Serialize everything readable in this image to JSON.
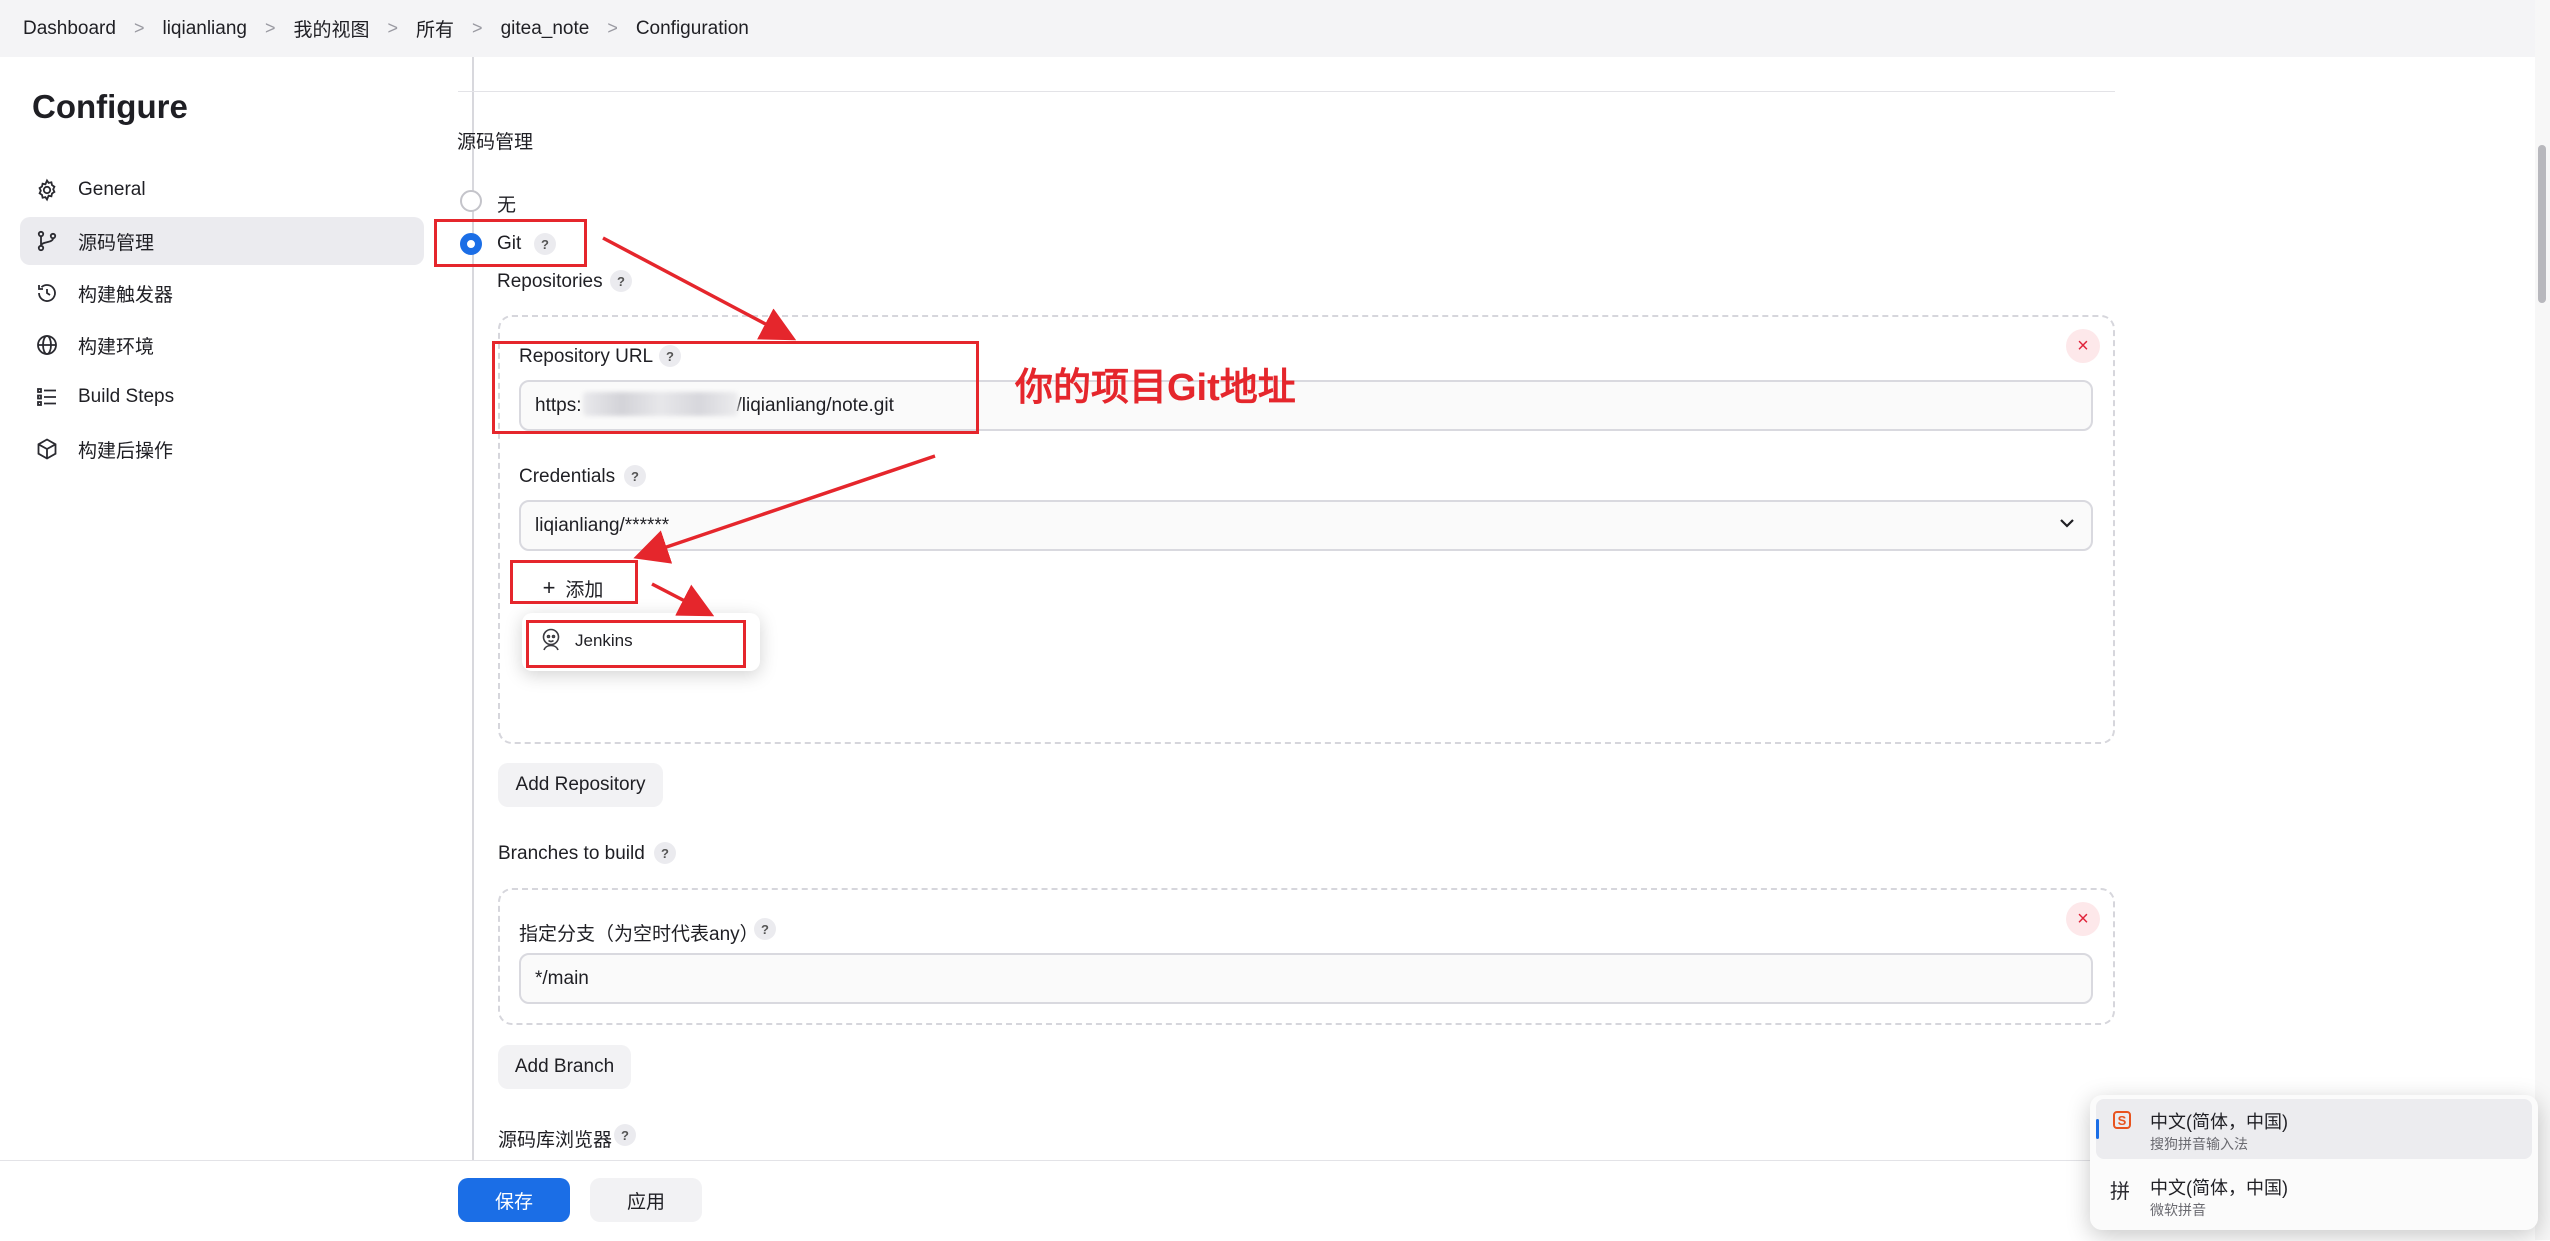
{
  "breadcrumb": [
    "Dashboard",
    "liqianliang",
    "我的视图",
    "所有",
    "gitea_note",
    "Configuration"
  ],
  "page_title": "Configure",
  "sidebar": {
    "items": [
      {
        "label": "General",
        "icon": "gear-icon"
      },
      {
        "label": "源码管理",
        "icon": "branch-icon"
      },
      {
        "label": "构建触发器",
        "icon": "clock-icon"
      },
      {
        "label": "构建环境",
        "icon": "globe-icon"
      },
      {
        "label": "Build Steps",
        "icon": "list-icon"
      },
      {
        "label": "构建后操作",
        "icon": "cube-icon"
      }
    ],
    "active_index": 1
  },
  "scm": {
    "section_title": "源码管理",
    "option_none": "无",
    "option_git": "Git",
    "selected": "Git",
    "repositories_label": "Repositories",
    "repository_url_label": "Repository URL",
    "repository_url_prefix": "https:",
    "repository_url_suffix": "/liqianliang/note.git",
    "credentials_label": "Credentials",
    "credentials_value": "liqianliang/******",
    "add_button": "添加",
    "add_icon": "+",
    "dropdown_item": "Jenkins",
    "add_repository_button": "Add Repository",
    "branches_label": "Branches to build",
    "branch_specifier_label": "指定分支（为空时代表any）",
    "branch_value": "*/main",
    "add_branch_button": "Add Branch",
    "repo_browser_label": "源码库浏览器",
    "help_symbol": "?",
    "remove_symbol": "×"
  },
  "annotation": "你的项目Git地址",
  "annotation_color": "#e5262c",
  "footer": {
    "save": "保存",
    "apply": "应用"
  },
  "accent_color": "#1b6ee6",
  "ime": {
    "items": [
      {
        "icon": "S",
        "main": "中文(简体，中国)",
        "sub": "搜狗拼音输入法"
      },
      {
        "icon": "拼",
        "main": "中文(简体，中国)",
        "sub": "微软拼音"
      }
    ]
  }
}
